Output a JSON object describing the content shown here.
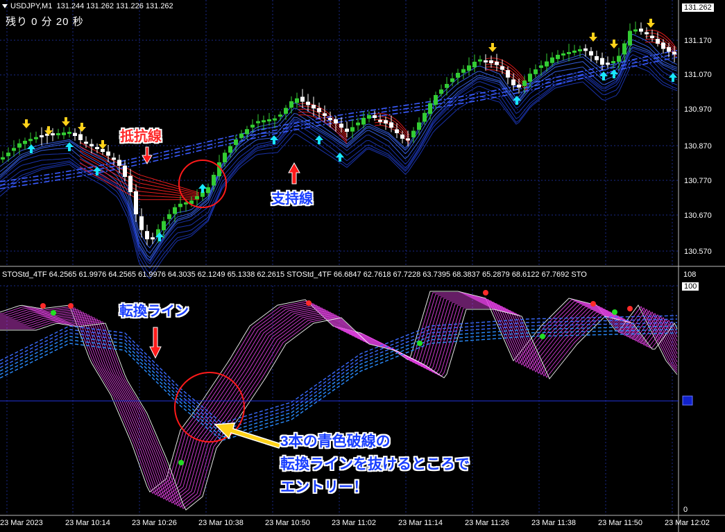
{
  "header": {
    "symbol": "USDJPY,M1",
    "ohlc": "131.244 131.262 131.226 131.262",
    "timer": "残り 0 分 20 秒"
  },
  "price_badge": "131.262",
  "price_axis": [
    "131.170",
    "131.070",
    "130.970",
    "130.870",
    "130.770",
    "130.670",
    "130.570"
  ],
  "indicator_header": "STOStd_4TF 64.2565 61.9976 64.2565 61.9976 64.3035 62.1249 65.1338 62.2615   STOStd_4TF 66.6847 62.7618 67.7228 63.7395 68.3837 65.2879 68.6122 67.7692  STO",
  "indicator_axis": {
    "top": "108",
    "upper": "100",
    "bottom": "0"
  },
  "time_axis": [
    "23 Mar 2023",
    "23 Mar 10:14",
    "23 Mar 10:26",
    "23 Mar 10:38",
    "23 Mar 10:50",
    "23 Mar 11:02",
    "23 Mar 11:14",
    "23 Mar 11:26",
    "23 Mar 11:38",
    "23 Mar 11:50",
    "23 Mar 12:02"
  ],
  "annotations": {
    "resistance": "抵抗線",
    "support": "支持線",
    "turn": "転換ライン",
    "entry_line1": "3本の青色破線の",
    "entry_line2": "転換ラインを抜けるところで",
    "entry_line3": "エントリー！"
  },
  "colors": {
    "background": "#000000",
    "bull": "#33cc33",
    "bear": "#ffffff",
    "resistance": "#ff2020",
    "support": "#2255ff",
    "stoch": "#e040e0",
    "callout": "#ff1a1a",
    "entry_arrow": "#ffd21a"
  }
}
